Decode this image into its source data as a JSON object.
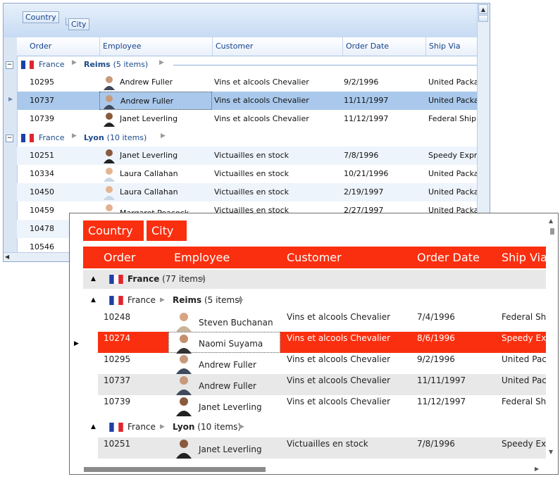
{
  "back": {
    "group_panel": {
      "chip1": "Country",
      "chip2": "City"
    },
    "columns": [
      "Order",
      "Employee",
      "Customer",
      "Order Date",
      "Ship Via"
    ],
    "groups": [
      {
        "country": "France",
        "city": "Reims",
        "count": "(5 items)"
      },
      {
        "country": "France",
        "city": "Lyon",
        "count": "(10 items)"
      }
    ],
    "rows": [
      {
        "order": "10295",
        "employee": "Andrew Fuller",
        "customer": "Vins et alcools Chevalier",
        "date": "9/2/1996",
        "ship": "United Package"
      },
      {
        "order": "10737",
        "employee": "Andrew Fuller",
        "customer": "Vins et alcools Chevalier",
        "date": "11/11/1997",
        "ship": "United Package"
      },
      {
        "order": "10739",
        "employee": "Janet Leverling",
        "customer": "Vins et alcools Chevalier",
        "date": "11/12/1997",
        "ship": "Federal Shipping"
      },
      {
        "order": "10251",
        "employee": "Janet Leverling",
        "customer": "Victuailles en stock",
        "date": "7/8/1996",
        "ship": "Speedy Express"
      },
      {
        "order": "10334",
        "employee": "Laura Callahan",
        "customer": "Victuailles en stock",
        "date": "10/21/1996",
        "ship": "United Package"
      },
      {
        "order": "10450",
        "employee": "Laura Callahan",
        "customer": "Victuailles en stock",
        "date": "2/19/1997",
        "ship": "United Package"
      },
      {
        "order": "10459",
        "employee": "Margaret Peacock",
        "customer": "Victuailles en stock",
        "date": "2/27/1997",
        "ship": "United Package"
      },
      {
        "order": "10478",
        "employee": "",
        "customer": "",
        "date": "",
        "ship": ""
      },
      {
        "order": "10546",
        "employee": "",
        "customer": "",
        "date": "",
        "ship": ""
      }
    ]
  },
  "front": {
    "group_panel": {
      "chip1": "Country",
      "chip2": "City"
    },
    "columns": [
      "Order",
      "Employee",
      "Customer",
      "Order Date",
      "Ship Via"
    ],
    "top_group": {
      "name": "France",
      "count": "(77 items)"
    },
    "groups": [
      {
        "country": "France",
        "city": "Reims",
        "count": "(5 items)"
      },
      {
        "country": "France",
        "city": "Lyon",
        "count": "(10 items)"
      }
    ],
    "rows": [
      {
        "order": "10248",
        "employee": "Steven Buchanan",
        "customer": "Vins et alcools Chevalier",
        "date": "7/4/1996",
        "ship": "Federal Shipping"
      },
      {
        "order": "10274",
        "employee": "Naomi Suyama",
        "customer": "Vins et alcools Chevalier",
        "date": "8/6/1996",
        "ship": "Speedy Express"
      },
      {
        "order": "10295",
        "employee": "Andrew Fuller",
        "customer": "Vins et alcools Chevalier",
        "date": "9/2/1996",
        "ship": "United Package"
      },
      {
        "order": "10737",
        "employee": "Andrew Fuller",
        "customer": "Vins et alcools Chevalier",
        "date": "11/11/1997",
        "ship": "United Package"
      },
      {
        "order": "10739",
        "employee": "Janet Leverling",
        "customer": "Vins et alcools Chevalier",
        "date": "11/12/1997",
        "ship": "Federal Shipping"
      },
      {
        "order": "10251",
        "employee": "Janet Leverling",
        "customer": "Victuailles en stock",
        "date": "7/8/1996",
        "ship": "Speedy Express"
      }
    ]
  },
  "icons": {
    "flag": "france-flag-icon",
    "expand": "collapse-toggle-icon",
    "chevron": "chevron-right-icon",
    "avatar": "employee-avatar-icon"
  },
  "colors": {
    "back_accent": "#15428b",
    "back_selection": "#a9c8eb",
    "front_accent": "#fa2f0f",
    "front_alt_row": "#e8e8e8"
  }
}
